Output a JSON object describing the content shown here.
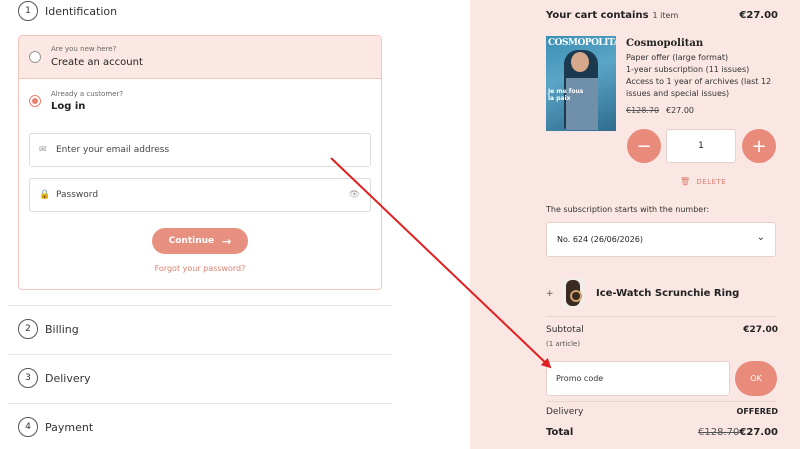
{
  "steps": [
    {
      "num": "1",
      "label": "Identification"
    },
    {
      "num": "2",
      "label": "Billing"
    },
    {
      "num": "3",
      "label": "Delivery"
    },
    {
      "num": "4",
      "label": "Payment"
    }
  ],
  "identification": {
    "new_small": "Are you new here?",
    "new_big": "Create an account",
    "login_small": "Already a customer?",
    "login_big": "Log in",
    "email_placeholder": "Enter your email address",
    "password_placeholder": "Password",
    "continue_label": "Continue",
    "forgot_label": "Forgot your password?"
  },
  "cart": {
    "title": "Your cart contains",
    "count": "1 item",
    "total_top": "€27.00",
    "product": {
      "cover_brand": "COSMOPOLITAN",
      "cover_text": "Je me fous\nla paix",
      "name": "Cosmopolitan",
      "desc": "Paper offer (large format)\n1-year subscription (11 issues)\nAccess to 1 year of archives (last 12 issues and special issues)",
      "old_price": "€128.70",
      "new_price": "€27.00",
      "quantity": "1",
      "minus": "−",
      "plus": "+",
      "delete_label": "DELETE"
    },
    "starts_label": "The subscription starts with the number:",
    "starts_value": "No. 624 (26/06/2026)",
    "gift": {
      "prefix": "+",
      "name": "Ice-Watch Scrunchie Ring"
    },
    "subtotal_label": "Subtotal",
    "articles_label": "(1 article)",
    "subtotal_value": "€27.00",
    "promo_placeholder": "Promo code",
    "ok_label": "OK",
    "delivery_label": "Delivery",
    "delivery_value": "OFFERED",
    "total_label": "Total",
    "total_old": "€128.70",
    "total_new": "€27.00"
  },
  "colors": {
    "accent": "#e88b7a",
    "panel_bg": "#fae6e3",
    "annotation_arrow": "#e02020"
  }
}
